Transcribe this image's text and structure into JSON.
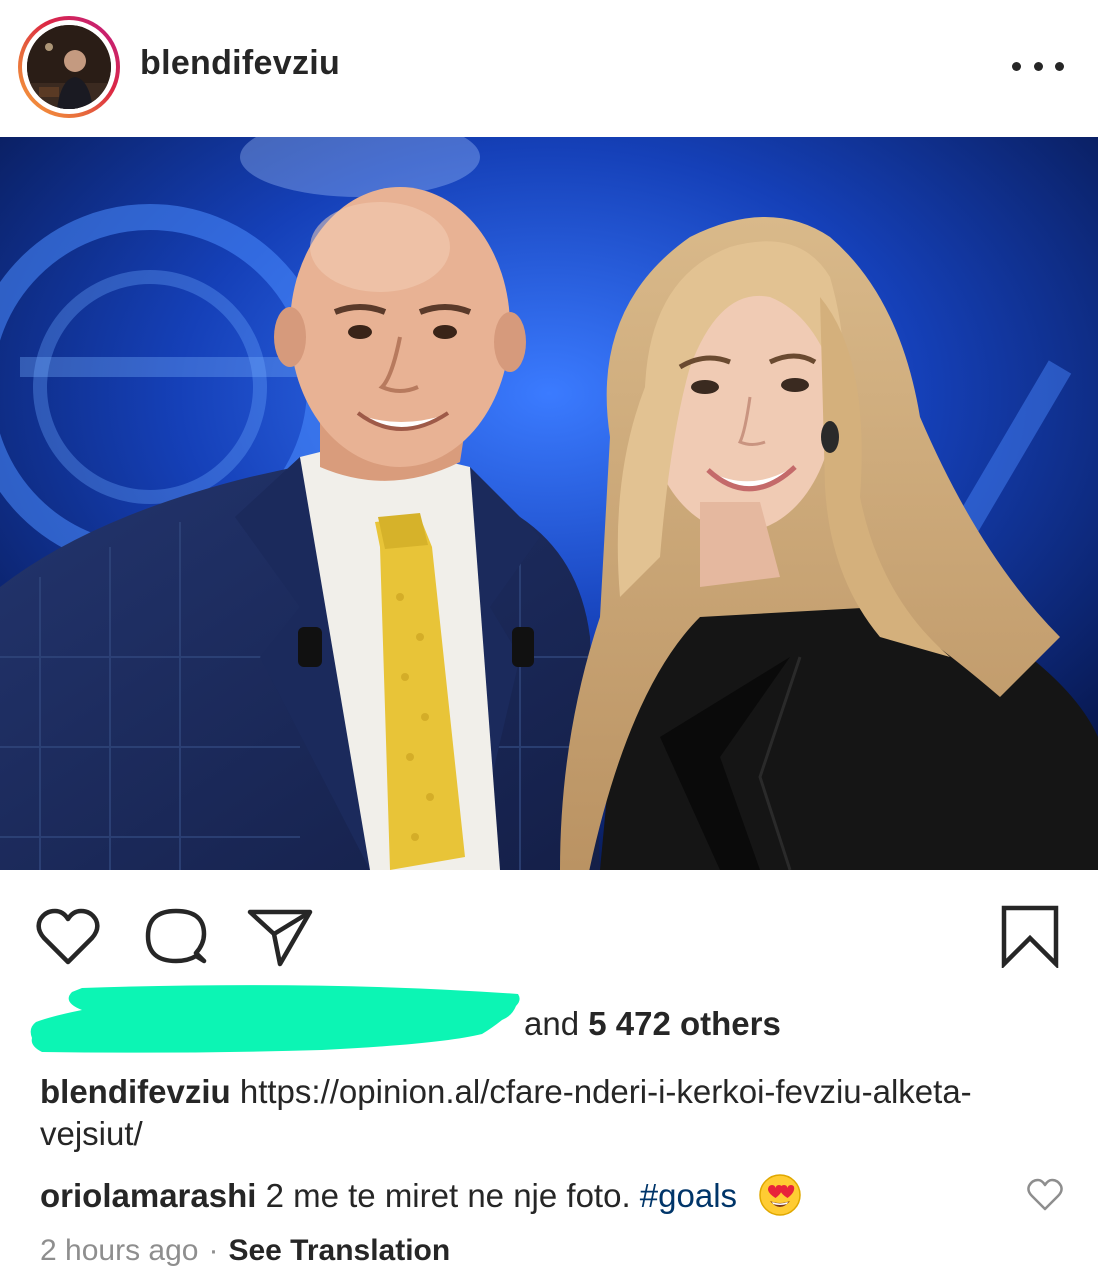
{
  "post": {
    "username": "blendifevziu",
    "more_menu_icon": "more-horizontal-icon"
  },
  "actions": {
    "like_icon": "heart-icon",
    "comment_icon": "comment-icon",
    "share_icon": "send-icon",
    "save_icon": "bookmark-icon"
  },
  "likes": {
    "prefix": "and ",
    "count": "5 472 others"
  },
  "caption": {
    "username": "blendifevziu",
    "text": "https://opinion.al/cfare-nderi-i-kerkoi-fevziu-alketa-vejsiut/"
  },
  "comment": {
    "username": "oriolamarashi",
    "text": "2 me te miret ne nje foto.",
    "hashtag": "#goals",
    "emoji": "heart-eyes-emoji"
  },
  "meta": {
    "time": "2 hours ago",
    "separator": "·",
    "see_translation": "See Translation"
  },
  "colors": {
    "text": "#262626",
    "muted": "#8e8e8e",
    "hashtag": "#003569",
    "redaction": "#0cf5b4"
  }
}
